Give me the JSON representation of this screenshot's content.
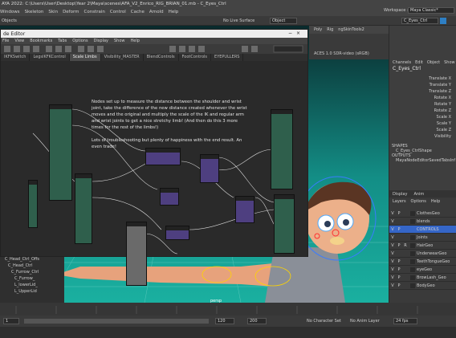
{
  "window": {
    "title": "AYA 2022: C:\\Users\\User\\Desktop\\Year 2\\Maya\\scenes\\AFA_V2_Enrico_RIG_BRIAN_01.mb - C_Eyes_Ctrl"
  },
  "menus": [
    "Windows",
    "Skeleton",
    "Skin",
    "Deform",
    "Constrain",
    "Control",
    "Cache",
    "Arnold",
    "Help"
  ],
  "shelf": {
    "objects_label": "Objects",
    "no_live_surface": "No Live Surface",
    "symmetry_label": "Object",
    "workspace_label": "Workspace :",
    "workspace_value": "Maya Classic*",
    "search_value": "C_Eyes_Ctrl"
  },
  "viewport": {
    "tabs": [
      "Poly",
      "Rig",
      "ngSkinTools2"
    ],
    "colorspace": "ACES 1.0 SDR-video (sRGB)",
    "camera_label": "persp"
  },
  "node_editor": {
    "title": "de Editor",
    "menu": [
      "File",
      "View",
      "Bookmarks",
      "Tabs",
      "Options",
      "Display",
      "Show",
      "Help"
    ],
    "tabs": [
      {
        "label": "IKFKSwitch",
        "active": false
      },
      {
        "label": "LegsIKFKControl",
        "active": false
      },
      {
        "label": "Scale Limbs",
        "active": true
      },
      {
        "label": "Visibility_MASTER",
        "active": false
      },
      {
        "label": "BlendControls",
        "active": false
      },
      {
        "label": "FootControls",
        "active": false
      },
      {
        "label": "EYEPULLERS",
        "active": false
      }
    ],
    "note": "Nodes set up to measure the distance between the shoulder and wrist joint, take the difference of the new distance created whenever the wrist moves and the original and multiply the scale of the IK and regular arm and wrist joints to get a nice stretchy limb! (And then do this 3 more times for the rest of the limbs!)",
    "note2": "Lots of troubleshooting but plenty of happiness with the end result. An even trade!"
  },
  "channel_box": {
    "menu": [
      "Channels",
      "Edit",
      "Object",
      "Show"
    ],
    "object": "C_Eyes_Ctrl",
    "attrs": [
      "Translate X",
      "Translate Y",
      "Translate Z",
      "Rotate X",
      "Rotate Y",
      "Rotate Z",
      "Scale X",
      "Scale Y",
      "Scale Z",
      "Visibility"
    ],
    "shapes_label": "SHAPES",
    "shape_name": "C_Eyes_CtrlShape",
    "outputs_label": "OUTPUTS",
    "output_name": "MayaNodeEditorSavedTabsInf"
  },
  "layers": {
    "tabs": [
      "Display",
      "Anim"
    ],
    "menu": [
      "Layers",
      "Options",
      "Help"
    ],
    "items": [
      {
        "v": "V",
        "p": "P",
        "r": "",
        "name": "ClothesGeo",
        "color": "#2b2b2b"
      },
      {
        "v": "V",
        "p": "",
        "r": "",
        "name": "blends",
        "color": "#2b2b2b"
      },
      {
        "v": "V",
        "p": "P",
        "r": "",
        "name": "CONTROLS",
        "color": "#3566c8"
      },
      {
        "v": "V",
        "p": "",
        "r": "",
        "name": "Joints",
        "color": "#2b2b2b"
      },
      {
        "v": "V",
        "p": "P",
        "r": "R",
        "name": "HairGeo",
        "color": "#2b2b2b"
      },
      {
        "v": "V",
        "p": "",
        "r": "",
        "name": "UnderwearGeo",
        "color": "#2b2b2b"
      },
      {
        "v": "V",
        "p": "P",
        "r": "",
        "name": "TeethTongueGeo",
        "color": "#2b2b2b"
      },
      {
        "v": "V",
        "p": "P",
        "r": "",
        "name": "eyeGeo",
        "color": "#2b2b2b"
      },
      {
        "v": "V",
        "p": "P",
        "r": "",
        "name": "BrowLash_Geo",
        "color": "#2b2b2b"
      },
      {
        "v": "V",
        "p": "P",
        "r": "",
        "name": "BodyGeo",
        "color": "#2b2b2b"
      }
    ]
  },
  "outliner": {
    "items": [
      "C_Head_Ctrl_Offs",
      "C_Head_Ctrl",
      "C_Furrow_Ctrl",
      "C_Furrow_",
      "L_lowerLid_",
      "L_UpperLid"
    ]
  },
  "range": {
    "start": "1",
    "end_anim": "120",
    "end": "120",
    "max": "200",
    "char_set": "No Character Set",
    "anim_layer": "No Anim Layer",
    "fps": "24 fps"
  }
}
